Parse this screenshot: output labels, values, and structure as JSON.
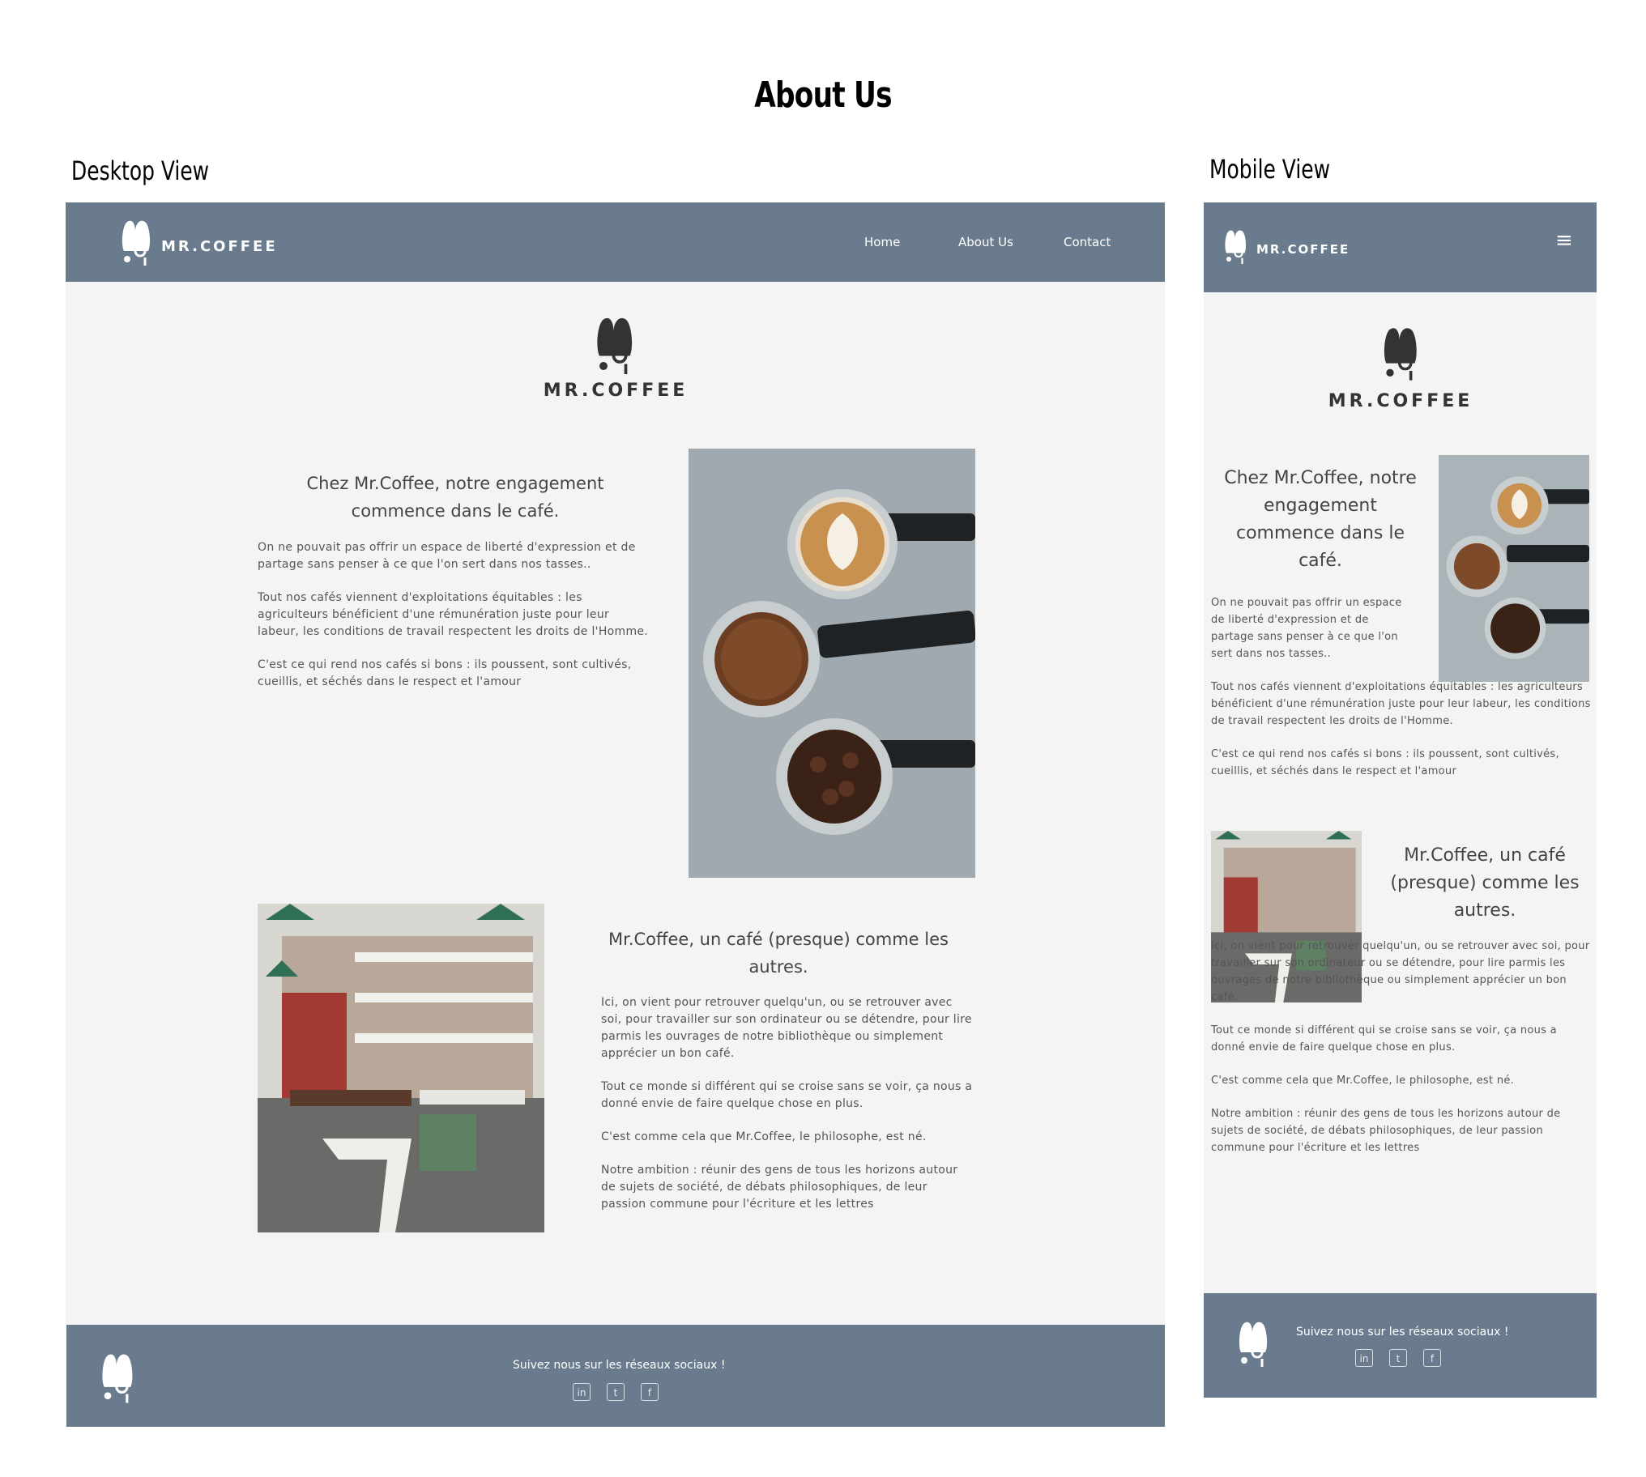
{
  "page_title": "About Us",
  "labels": {
    "desktop": "Desktop View",
    "mobile": "Mobile View"
  },
  "brand": "MR.COFFEE",
  "nav": {
    "items": [
      "Home",
      "About Us",
      "Contact"
    ]
  },
  "section1": {
    "heading": "Chez Mr.Coffee, notre engagement commence dans le café.",
    "paragraphs": [
      "On ne pouvait pas offrir un espace de liberté d'expression et de partage sans penser à ce que l'on sert dans nos tasses..",
      "Tout nos cafés viennent d'exploitations équitables : les agriculteurs bénéficient d'une rémunération juste pour leur labeur, les conditions de travail respectent les droits de l'Homme.",
      "C'est ce qui rend nos cafés si bons : ils poussent, sont cultivés, cueillis, et séchés dans le respect et l'amour"
    ]
  },
  "section2": {
    "heading": "Mr.Coffee, un café (presque) comme les autres.",
    "paragraphs": [
      "Ici, on vient pour retrouver quelqu'un, ou se retrouver avec soi, pour travailler sur son ordinateur ou se détendre, pour lire parmis les ouvrages de notre bibliothèque ou simplement apprécier un bon café.",
      "Tout ce monde si différent qui se croise sans se voir, ça nous a donné envie de faire quelque chose en plus.",
      "C'est comme cela que Mr.Coffee, le philosophe, est né.",
      "Notre ambition : réunir des gens de tous les horizons autour de sujets de société, de débats philosophiques, de leur passion commune pour l'écriture et les lettres"
    ]
  },
  "footer": {
    "follow": "Suivez nous sur les réseaux sociaux !",
    "icons": [
      "linkedin-icon",
      "twitter-icon",
      "facebook-icon"
    ]
  },
  "mobile": {
    "menu_icon": "≡"
  },
  "colors": {
    "nav": "#697b8c",
    "background": "#f4f4f4"
  }
}
